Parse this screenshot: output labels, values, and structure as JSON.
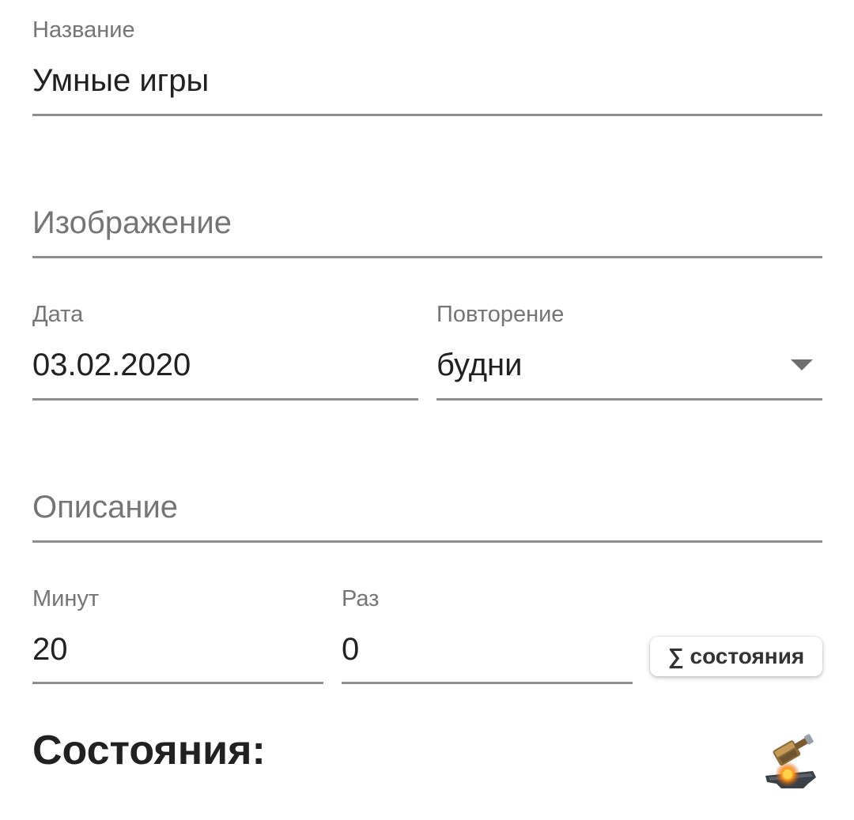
{
  "form": {
    "name": {
      "label": "Название",
      "value": "Умные игры"
    },
    "image": {
      "placeholder": "Изображение"
    },
    "date": {
      "label": "Дата",
      "value": "03.02.2020"
    },
    "repeat": {
      "label": "Повторение",
      "value": "будни"
    },
    "description": {
      "placeholder": "Описание"
    },
    "minutes": {
      "label": "Минут",
      "value": "20"
    },
    "times": {
      "label": "Раз",
      "value": "0"
    },
    "states_chip": {
      "label": "∑ состояния"
    }
  },
  "states_section": {
    "title": "Состояния:",
    "icon": "anvil-hammer-icon"
  },
  "colors": {
    "underline": "#8e8e8e",
    "label": "#757575",
    "text": "#212121"
  }
}
